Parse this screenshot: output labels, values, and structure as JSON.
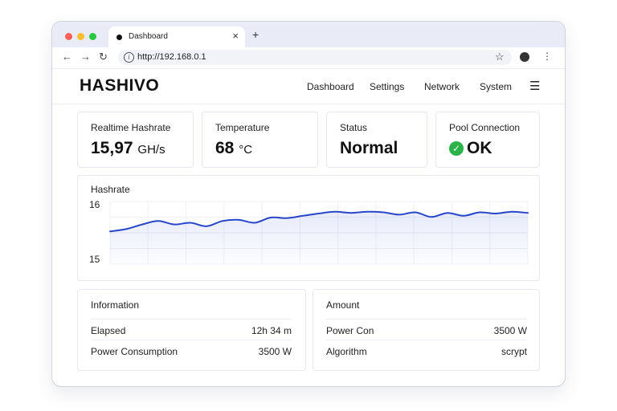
{
  "browser": {
    "tab_title": "Dashboard",
    "url": "http://192.168.0.1",
    "colors": {
      "close": "#ff5f57",
      "minimize": "#febc2e",
      "maximize": "#28c840"
    }
  },
  "app": {
    "logo": "HASHIVO",
    "nav": [
      "Dashboard",
      "Settings",
      "Network",
      "System"
    ]
  },
  "stats": [
    {
      "label": "Realtime Hashrate",
      "value": "15,97",
      "unit": "GH/s"
    },
    {
      "label": "Temperature",
      "value": "68",
      "unit": "°C"
    },
    {
      "label": "Status",
      "value": "Normal"
    },
    {
      "label": "Pool Connection",
      "value": "OK"
    }
  ],
  "chart": {
    "title": "Hashrate",
    "chart_data": {
      "type": "area",
      "ylim": [
        15,
        16
      ],
      "yticks": [
        "16",
        "15"
      ],
      "grid": true,
      "line_color": "#2846c8",
      "x": [
        0,
        1,
        2,
        3,
        4,
        5,
        6,
        7,
        8,
        9,
        10,
        11,
        12,
        13,
        14,
        15,
        16,
        17,
        18,
        19,
        20,
        21,
        22,
        23,
        24,
        25,
        26
      ],
      "values": [
        15.51,
        15.55,
        15.63,
        15.69,
        15.63,
        15.66,
        15.6,
        15.69,
        15.71,
        15.66,
        15.75,
        15.74,
        15.78,
        15.82,
        15.85,
        15.83,
        15.85,
        15.84,
        15.8,
        15.84,
        15.76,
        15.83,
        15.78,
        15.84,
        15.82,
        15.85,
        15.83
      ]
    }
  },
  "information": {
    "title": "Information",
    "rows": [
      {
        "label": "Elapsed",
        "value": "12h 34 m"
      },
      {
        "label": "Power Consumption",
        "value": "3500 W"
      }
    ]
  },
  "amount": {
    "title": "Amount",
    "rows": [
      {
        "label": "Power Con",
        "value": "3500 W"
      },
      {
        "label": "Algorithm",
        "value": "scrypt"
      }
    ]
  }
}
